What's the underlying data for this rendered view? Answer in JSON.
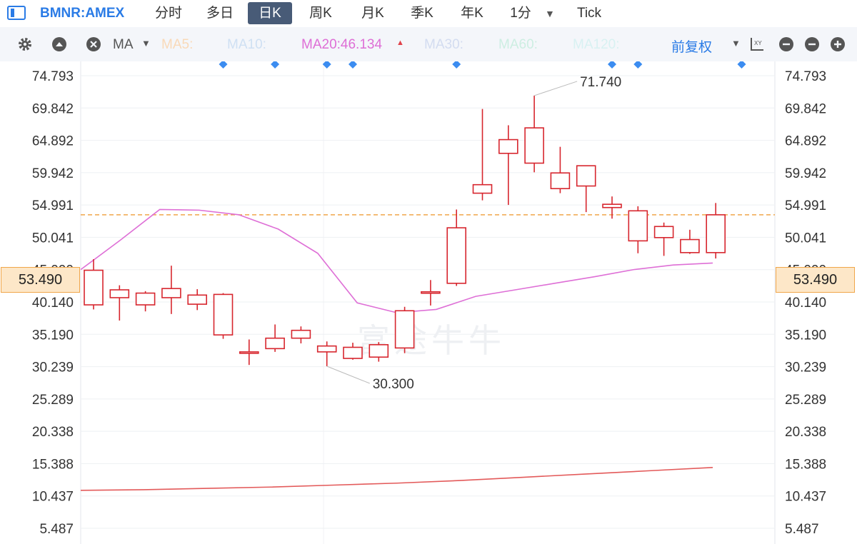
{
  "header": {
    "symbol": "BMNR:AMEX",
    "tabs": [
      {
        "label": "分时"
      },
      {
        "label": "多日"
      },
      {
        "label": "日K"
      },
      {
        "label": "周K"
      },
      {
        "label": "月K"
      },
      {
        "label": "季K"
      },
      {
        "label": "年K"
      },
      {
        "label": "1分"
      },
      {
        "label": "Tick"
      }
    ],
    "active_tab": "日K"
  },
  "toolbar": {
    "ma_selector": "MA",
    "ma_labels": [
      {
        "label": "MA5:",
        "color": "#f9d9b8"
      },
      {
        "label": "MA10:",
        "color": "#cfe0f3"
      },
      {
        "label": "MA20:46.134",
        "color": "#de6fd6"
      },
      {
        "label": "MA30:",
        "color": "#d3dcf0"
      },
      {
        "label": "MA60:",
        "color": "#cdeee2"
      },
      {
        "label": "MA120:",
        "color": "#d8f1f2"
      }
    ],
    "adjust_label": "前复权"
  },
  "watermark": "富途牛牛",
  "colors": {
    "up": "#d7262e",
    "down": "#0e9a1f",
    "accent": "#2a7be6",
    "ma20": "#de6fd6",
    "ma_long": "#e35a5a",
    "price_line": "#f0a64a",
    "marker": "#3b8cf0"
  },
  "chart_data": {
    "type": "candlestick",
    "y_ticks": [
      "74.793",
      "69.842",
      "64.892",
      "59.942",
      "54.991",
      "50.041",
      "45.090",
      "40.140",
      "35.190",
      "30.239",
      "25.289",
      "20.338",
      "15.388",
      "10.437",
      "5.487"
    ],
    "ylim": [
      5.487,
      74.793
    ],
    "current_price": "53.490",
    "annotations": [
      {
        "text": "71.740",
        "candle_index": 17,
        "value": 71.74
      },
      {
        "text": "30.300",
        "candle_index": 9,
        "value": 30.3
      }
    ],
    "candles": [
      {
        "o": 39.7,
        "h": 46.7,
        "l": 39.0,
        "c": 45.0
      },
      {
        "o": 40.8,
        "h": 42.7,
        "l": 37.3,
        "c": 42.0
      },
      {
        "o": 39.7,
        "h": 41.8,
        "l": 38.7,
        "c": 41.5
      },
      {
        "o": 40.8,
        "h": 45.7,
        "l": 38.3,
        "c": 42.2
      },
      {
        "o": 39.8,
        "h": 42.1,
        "l": 38.9,
        "c": 41.2
      },
      {
        "o": 35.1,
        "h": 41.5,
        "l": 34.5,
        "c": 41.3
      },
      {
        "o": 32.3,
        "h": 34.4,
        "l": 30.5,
        "c": 32.5
      },
      {
        "o": 33.0,
        "h": 36.7,
        "l": 32.5,
        "c": 34.6
      },
      {
        "o": 34.6,
        "h": 36.4,
        "l": 33.8,
        "c": 35.8
      },
      {
        "o": 32.5,
        "h": 34.1,
        "l": 30.3,
        "c": 33.4
      },
      {
        "o": 31.5,
        "h": 33.9,
        "l": 31.3,
        "c": 33.2
      },
      {
        "o": 31.7,
        "h": 34.0,
        "l": 31.0,
        "c": 33.6
      },
      {
        "o": 33.1,
        "h": 39.4,
        "l": 32.3,
        "c": 38.8
      },
      {
        "o": 41.5,
        "h": 43.5,
        "l": 39.6,
        "c": 41.7
      },
      {
        "o": 43.0,
        "h": 54.3,
        "l": 42.6,
        "c": 51.5
      },
      {
        "o": 56.8,
        "h": 69.7,
        "l": 55.7,
        "c": 58.1
      },
      {
        "o": 62.9,
        "h": 67.2,
        "l": 55.0,
        "c": 65.0
      },
      {
        "o": 61.4,
        "h": 71.74,
        "l": 60.0,
        "c": 66.8
      },
      {
        "o": 57.5,
        "h": 63.9,
        "l": 56.8,
        "c": 59.9
      },
      {
        "o": 57.9,
        "h": 60.8,
        "l": 53.9,
        "c": 61.0
      },
      {
        "o": 54.6,
        "h": 56.3,
        "l": 52.9,
        "c": 55.1
      },
      {
        "o": 49.5,
        "h": 54.8,
        "l": 47.6,
        "c": 54.1
      },
      {
        "o": 50.0,
        "h": 52.3,
        "l": 47.2,
        "c": 51.7
      },
      {
        "o": 47.7,
        "h": 51.2,
        "l": 47.5,
        "c": 49.7
      },
      {
        "o": 47.7,
        "h": 55.3,
        "l": 46.8,
        "c": 53.49
      }
    ],
    "ma_markers": [
      3,
      5,
      7,
      8,
      12,
      18,
      19,
      23
    ],
    "ma20": [
      45.1,
      49.6,
      54.3,
      54.2,
      53.5,
      51.3,
      47.6,
      40.0,
      38.5,
      39.0,
      41.0,
      42.0,
      43.0,
      44.0,
      45.1,
      45.8,
      46.1
    ],
    "ma_long": [
      11.3,
      11.4,
      11.6,
      11.8,
      12.1,
      12.4,
      12.8,
      13.3,
      13.8,
      14.3,
      14.8
    ]
  }
}
